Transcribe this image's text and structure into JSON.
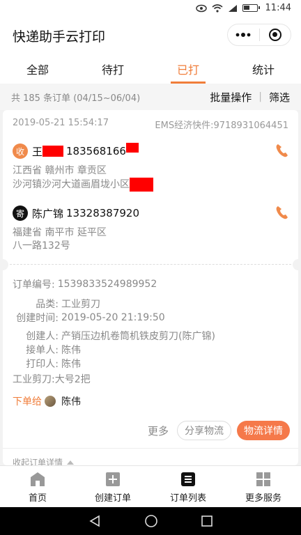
{
  "status_bar": {
    "time": "11:44",
    "icons": [
      "eye-icon",
      "wifi-icon",
      "signal-icon",
      "battery-icon"
    ]
  },
  "header": {
    "title": "快递助手云打印",
    "menu_icon": "more-dots-icon",
    "close_icon": "target-icon"
  },
  "tabs": [
    {
      "label": "全部",
      "active": false
    },
    {
      "label": "待打",
      "active": false
    },
    {
      "label": "已打",
      "active": true
    },
    {
      "label": "统计",
      "active": false
    }
  ],
  "summary": {
    "text": "共 185 条订单 (04/15~06/04)",
    "batch": "批量操作",
    "divider": "|",
    "filter": "筛选"
  },
  "order": {
    "datetime": "2019-05-21 15:54:17",
    "carrier": "EMS经济快件:9718931064451",
    "receiver": {
      "badge": "收",
      "name": "王",
      "phone": "183568166",
      "region": "江西省 赣州市 章贡区",
      "street": "沙河镇沙河大道画眉垅小区"
    },
    "sender": {
      "badge": "寄",
      "name": "陈广锦",
      "phone": "13328387920",
      "region": "福建省 南平市 延平区",
      "street": "八一路132号"
    },
    "details": [
      {
        "key": "订单编号:",
        "value": "1539833524989952"
      },
      {
        "key": "品类:",
        "value": "工业剪刀"
      },
      {
        "key": "创建时间:",
        "value": "2019-05-20 21:19:50"
      },
      {
        "key": "创建人:",
        "value": "产销压边机卷筒机铁皮剪刀(陈广锦)"
      },
      {
        "key": "接单人:",
        "value": "陈伟"
      },
      {
        "key": "打印人:",
        "value": "陈伟"
      }
    ],
    "note": "工业剪刀:大号2把",
    "dispatch_label": "下单给",
    "dispatch_to": "陈伟",
    "more": "更多",
    "share_button": "分享物流",
    "detail_button": "物流详情",
    "collapse": "收起订单详情"
  },
  "bottom_nav": [
    {
      "label": "首页",
      "icon": "home-icon"
    },
    {
      "label": "创建订单",
      "icon": "add-order-icon"
    },
    {
      "label": "订单列表",
      "icon": "order-list-icon"
    },
    {
      "label": "更多服务",
      "icon": "grid-icon"
    }
  ],
  "colors": {
    "accent": "#f07d3a",
    "button": "#f5794a",
    "redact": "#ff0000"
  }
}
